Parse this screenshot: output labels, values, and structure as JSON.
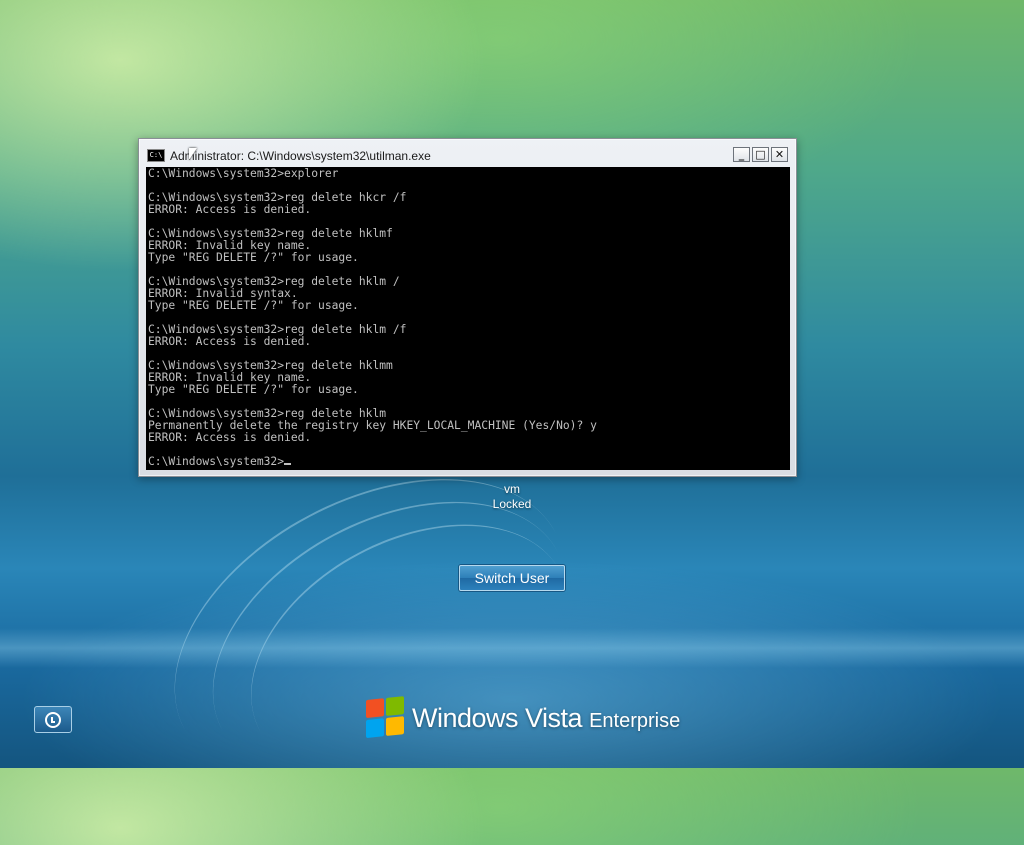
{
  "window": {
    "title": "Administrator: C:\\Windows\\system32\\utilman.exe",
    "icon": "C:\\",
    "buttons": {
      "minimize": "_",
      "maximize": "□",
      "close": "✕"
    }
  },
  "console": {
    "lines": [
      "C:\\Windows\\system32>explorer",
      "",
      "C:\\Windows\\system32>reg delete hkcr /f",
      "ERROR: Access is denied.",
      "",
      "C:\\Windows\\system32>reg delete hklmf",
      "ERROR: Invalid key name.",
      "Type \"REG DELETE /?\" for usage.",
      "",
      "C:\\Windows\\system32>reg delete hklm /",
      "ERROR: Invalid syntax.",
      "Type \"REG DELETE /?\" for usage.",
      "",
      "C:\\Windows\\system32>reg delete hklm /f",
      "ERROR: Access is denied.",
      "",
      "C:\\Windows\\system32>reg delete hklmm",
      "ERROR: Invalid key name.",
      "Type \"REG DELETE /?\" for usage.",
      "",
      "C:\\Windows\\system32>reg delete hklm",
      "Permanently delete the registry key HKEY_LOCAL_MACHINE (Yes/No)? y",
      "ERROR: Access is denied.",
      ""
    ],
    "prompt": "C:\\Windows\\system32>"
  },
  "user": {
    "name": "vm",
    "status": "Locked"
  },
  "switch_user_label": "Switch User",
  "brand": {
    "name": "Windows Vista",
    "edition": "Enterprise"
  },
  "icons": {
    "ease_of_access": "ease-of-access-icon",
    "logo": "windows-flag-icon",
    "pointer": "mouse-pointer-icon"
  }
}
